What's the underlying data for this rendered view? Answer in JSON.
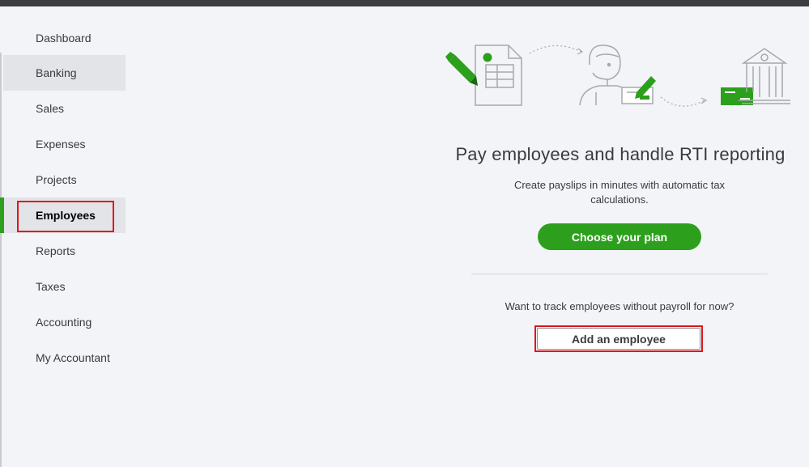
{
  "sidebar": {
    "items": [
      {
        "label": "Dashboard"
      },
      {
        "label": "Banking"
      },
      {
        "label": "Sales"
      },
      {
        "label": "Expenses"
      },
      {
        "label": "Projects"
      },
      {
        "label": "Employees"
      },
      {
        "label": "Reports"
      },
      {
        "label": "Taxes"
      },
      {
        "label": "Accounting"
      },
      {
        "label": "My Accountant"
      }
    ],
    "active_item": "Employees",
    "highlighted_item": "Banking"
  },
  "main": {
    "headline": "Pay employees and handle RTI reporting",
    "subtext": "Create payslips in minutes with automatic tax calculations.",
    "primary_button": "Choose your plan",
    "question": "Want to track employees without payroll for now?",
    "secondary_button": "Add an employee"
  },
  "illustration": {
    "icons": [
      "pencil-icon",
      "document-icon",
      "person-icon",
      "signature-pen-icon",
      "payslip-card-icon",
      "check-card-icon",
      "bank-icon"
    ]
  },
  "colors": {
    "accent_green": "#2ca01c",
    "annotation_red": "#e3141b",
    "page_bg": "#f3f4f7",
    "topbar": "#3b3d42"
  }
}
